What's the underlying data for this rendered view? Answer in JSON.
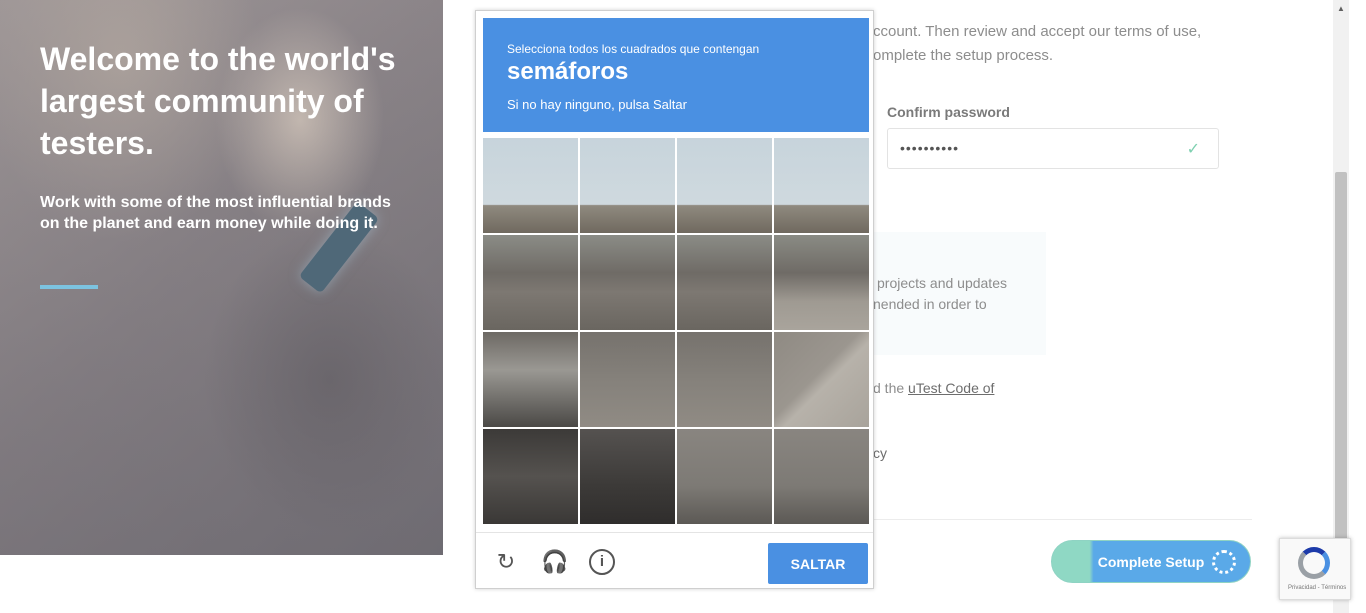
{
  "hero": {
    "title": "Welcome to the world's largest community of testers.",
    "subtitle": "Work with some of the most influential brands on the planet and earn money while doing it."
  },
  "form": {
    "intro_line1": "ccount. Then review and accept our terms of use,",
    "intro_line2": "omplete the setup process.",
    "confirm_password_label": "Confirm password",
    "confirm_password_value": "••••••••••",
    "info_line1": "projects and updates",
    "info_line2": "nended in order to",
    "code_prefix": "d the ",
    "code_link": "uTest Code of",
    "policy_fragment": "cy",
    "complete_button": "Complete Setup"
  },
  "captcha": {
    "instruction": "Selecciona todos los cuadrados que contengan",
    "target": "semáforos",
    "skip_hint": "Si no hay ninguno, pulsa Saltar",
    "skip_button": "SALTAR",
    "icons": [
      "reload-icon",
      "audio-icon",
      "info-icon"
    ],
    "grid_rows": 4,
    "grid_cols": 4
  },
  "recaptcha_badge": {
    "terms": "Privacidad - Términos"
  },
  "colors": {
    "captcha_blue": "#4a90e2",
    "accent_teal": "#8fd8c4",
    "hero_line": "#7cc3e0"
  }
}
